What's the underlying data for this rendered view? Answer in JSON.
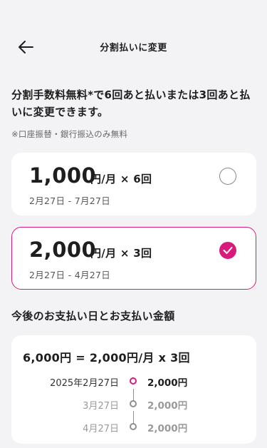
{
  "header": {
    "title": "分割払いに変更",
    "back_icon": "arrow-left-icon"
  },
  "intro": {
    "text": "分割手数料無料*で6回あと払いまたは3回あと払いに変更できます。",
    "note": "※口座振替・銀行振込のみ無料"
  },
  "plans": [
    {
      "amount": "1,000",
      "unit": "円/月 × 6回",
      "dates": "2月27日 - 7月27日",
      "selected": false
    },
    {
      "amount": "2,000",
      "unit": "円/月 × 3回",
      "dates": "2月27日 - 4月27日",
      "selected": true
    }
  ],
  "schedule": {
    "title": "今後のお支払い日とお支払い金額",
    "summary": "6,000円 = 2,000円/月 x 3回",
    "rows": [
      {
        "date": "2025年2月27日",
        "amount": "2,000円"
      },
      {
        "date": "3月27日",
        "amount": "2,000円"
      },
      {
        "date": "4月27日",
        "amount": "2,000円"
      }
    ]
  },
  "colors": {
    "accent": "#d81a7c",
    "background": "#f3f3f5"
  }
}
